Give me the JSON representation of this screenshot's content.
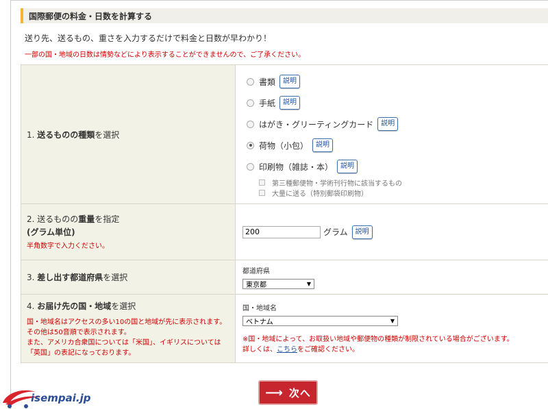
{
  "section": {
    "title": "国際郵便の料金・日数を計算する"
  },
  "lead": "送り先、送るもの、重さを入力するだけで料金と日数が早わかり！",
  "notice": "一部の国・地域の日数は情勢などにより表示することができませんので、ご了承ください。",
  "explain_label": "説明",
  "step1": {
    "num": "1.",
    "bold": "送るものの種類",
    "suffix": "を選択",
    "options": [
      {
        "label": "書類",
        "selected": false
      },
      {
        "label": "手紙",
        "selected": false
      },
      {
        "label": "はがき・グリーティングカード",
        "selected": false
      },
      {
        "label": "荷物（小包）",
        "selected": true
      },
      {
        "label": "印刷物（雑誌・本）",
        "selected": false
      }
    ],
    "sub_options": [
      "第三種郵便物・学術刊行物に該当するもの",
      "大量に送る（特別郵袋印刷物）"
    ]
  },
  "step2": {
    "num": "2.",
    "pre": "送るものの",
    "bold": "重量",
    "suffix": "を指定",
    "line2": "(グラム単位)",
    "note": "半角数字で入力ください。",
    "value": "200",
    "unit": "グラム"
  },
  "step3": {
    "num": "3.",
    "bold": "差し出す都道府県",
    "suffix": "を選択",
    "field_label": "都道府県",
    "selected": "東京都"
  },
  "step4": {
    "num": "4.",
    "bold": "お届け先の国・地域",
    "suffix": "を選択",
    "notes": [
      "国・地域名はアクセスの多い10の国と地域が先に表示されます。",
      "その他は50音順で表示されます。",
      "また、アメリカ合衆国については「米国」、イギリスについては",
      "「英国」の表記になっております。"
    ],
    "field_label": "国・地域名",
    "selected": "ベトナム",
    "warning1": "※国・地域によって、お取扱い地域や郵便物の種類が制限されている場合がございます。",
    "warning2_pre": "詳しくは、",
    "warning2_link": "こちら",
    "warning2_post": "をご確認ください。"
  },
  "next_button": {
    "label": "次へ",
    "arrow": "⟶"
  },
  "logo": {
    "text": "isempai.jp"
  }
}
